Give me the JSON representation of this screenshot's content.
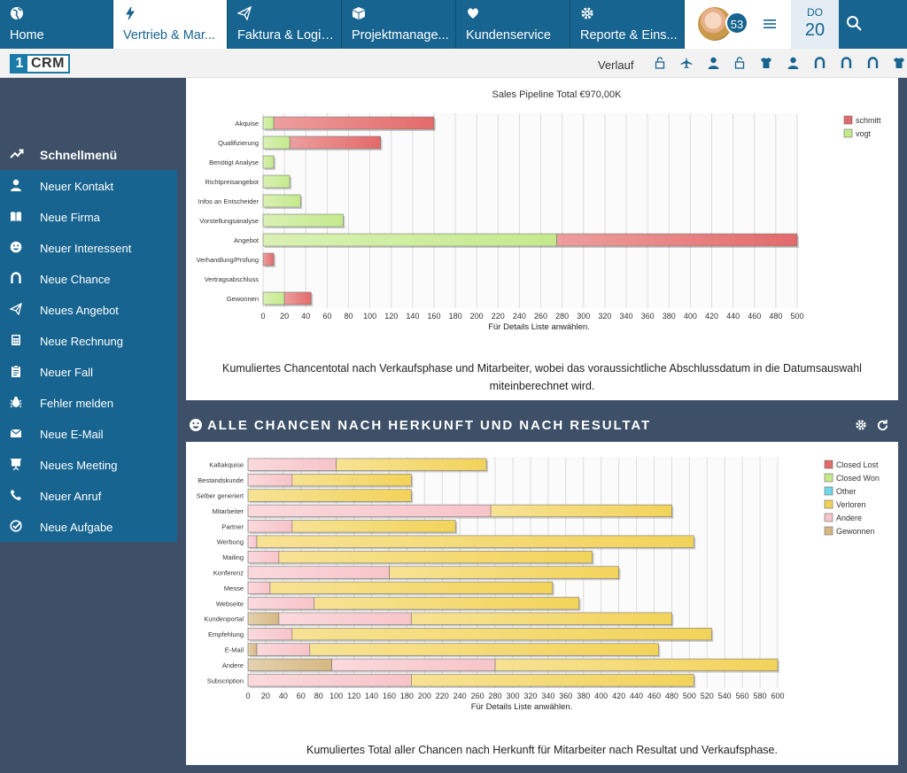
{
  "topnav": {
    "tabs": [
      {
        "label": "Home",
        "icon": "globe-icon",
        "active": false
      },
      {
        "label": "Vertrieb & Mar...",
        "icon": "lightning-icon",
        "active": true
      },
      {
        "label": "Faktura & Logis...",
        "icon": "paper-plane-icon",
        "active": false
      },
      {
        "label": "Projektmanage...",
        "icon": "cube-icon",
        "active": false
      },
      {
        "label": "Kundenservice",
        "icon": "heart-icon",
        "active": false
      },
      {
        "label": "Reporte & Eins...",
        "icon": "gear-icon",
        "active": false
      }
    ],
    "badge_count": "53",
    "date_dow": "DO",
    "date_day": "20"
  },
  "subbar": {
    "logo_one": "1",
    "logo_crm": "CRM",
    "history_label": "Verlauf",
    "history_icons": [
      "lock-icon",
      "plane-icon",
      "person-icon",
      "lock-icon",
      "shirt-icon",
      "person-icon",
      "magnet-icon",
      "magnet-icon",
      "magnet-icon",
      "shirt-icon"
    ]
  },
  "sidebar": {
    "heading": "Schnellmenü",
    "items": [
      {
        "label": "Neuer Kontakt",
        "icon": "person-icon"
      },
      {
        "label": "Neue Firma",
        "icon": "book-icon"
      },
      {
        "label": "Neuer Interessent",
        "icon": "smile-icon"
      },
      {
        "label": "Neue Chance",
        "icon": "magnet-icon"
      },
      {
        "label": "Neues Angebot",
        "icon": "paper-plane-icon"
      },
      {
        "label": "Neue Rechnung",
        "icon": "calculator-icon"
      },
      {
        "label": "Neuer Fall",
        "icon": "clipboard-icon"
      },
      {
        "label": "Fehler melden",
        "icon": "bug-icon"
      },
      {
        "label": "Neue E-Mail",
        "icon": "envelope-icon"
      },
      {
        "label": "Neues Meeting",
        "icon": "presentation-icon"
      },
      {
        "label": "Neuer Anruf",
        "icon": "phone-icon"
      },
      {
        "label": "Neue Aufgabe",
        "icon": "check-circle-icon"
      }
    ]
  },
  "panel1": {
    "caption": "Kumuliertes Chancentotal nach Verkaufsphase und Mitarbeiter, wobei das voraussichtliche Abschlussdatum in die Datumsauswahl miteinberechnet wird."
  },
  "panel2": {
    "heading": "ALLE CHANCEN NACH HERKUNFT UND NACH RESULTAT",
    "caption": "Kumuliertes Total aller Chancen nach Herkunft für Mitarbeiter nach Resultat und Verkaufsphase."
  },
  "colors": {
    "nav": "#176490",
    "red": "#e36a6a",
    "green": "#c4ea8c",
    "cyan": "#6fd8e8",
    "yellow": "#f2d35a",
    "pink": "#f7c4c9",
    "tan": "#d6b882"
  },
  "chart_data": [
    {
      "type": "bar",
      "orientation": "horizontal",
      "stacked": true,
      "title": "Sales Pipeline Total €970,00K",
      "xlabel": "Für Details Liste anwählen.",
      "xlim": [
        0,
        500
      ],
      "xticks": [
        0,
        20,
        40,
        60,
        80,
        100,
        120,
        140,
        160,
        180,
        200,
        220,
        240,
        260,
        280,
        300,
        320,
        340,
        360,
        380,
        400,
        420,
        440,
        460,
        480,
        500
      ],
      "legend_position": "top-right",
      "categories": [
        "Akquise",
        "Qualifizierung",
        "Benötigt Analyse",
        "Richtpreisangebot",
        "Infos an Entscheider",
        "Vorstellungsanalyse",
        "Angebot",
        "Verhandlung/Prüfung",
        "Vertragsabschluss",
        "Gewonnen"
      ],
      "series": [
        {
          "name": "vogt",
          "color": "#c4ea8c",
          "values": [
            10,
            25,
            10,
            25,
            35,
            75,
            275,
            0,
            0,
            20
          ]
        },
        {
          "name": "schmitt",
          "color": "#e36a6a",
          "values": [
            150,
            85,
            0,
            0,
            0,
            0,
            225,
            10,
            0,
            25
          ]
        }
      ],
      "legend": [
        {
          "name": "schmitt",
          "color": "#e36a6a"
        },
        {
          "name": "vogt",
          "color": "#c4ea8c"
        }
      ]
    },
    {
      "type": "bar",
      "orientation": "horizontal",
      "stacked": true,
      "title": "",
      "xlabel": "Für Details Liste anwählen.",
      "xlim": [
        0,
        600
      ],
      "xticks": [
        0,
        20,
        40,
        60,
        80,
        100,
        120,
        140,
        160,
        180,
        200,
        220,
        240,
        260,
        280,
        300,
        320,
        340,
        360,
        380,
        400,
        420,
        440,
        460,
        480,
        500,
        520,
        540,
        560,
        580,
        600
      ],
      "legend_position": "top-right",
      "categories": [
        "Kaltakquise",
        "Bestandskunde",
        "Selber generiert",
        "Mitarbeiter",
        "Partner",
        "Werbung",
        "Mailing",
        "Konferenz",
        "Messe",
        "Webseite",
        "Kundenportal",
        "Empfehlung",
        "E-Mail",
        "Andere",
        "Subscription"
      ],
      "series": [
        {
          "name": "Gewonnen",
          "color": "#d6b882",
          "values": [
            0,
            0,
            0,
            0,
            0,
            0,
            0,
            0,
            0,
            0,
            35,
            0,
            10,
            95,
            0
          ]
        },
        {
          "name": "Andere",
          "color": "#f7c4c9",
          "values": [
            100,
            50,
            0,
            275,
            50,
            10,
            35,
            160,
            25,
            75,
            150,
            50,
            60,
            185,
            185
          ]
        },
        {
          "name": "Verloren",
          "color": "#f2d35a",
          "values": [
            170,
            135,
            185,
            205,
            185,
            495,
            355,
            260,
            320,
            300,
            295,
            475,
            395,
            320,
            320
          ]
        }
      ],
      "legend": [
        {
          "name": "Closed Lost",
          "color": "#e36a6a"
        },
        {
          "name": "Closed Won",
          "color": "#c4ea8c"
        },
        {
          "name": "Other",
          "color": "#6fd8e8"
        },
        {
          "name": "Verloren",
          "color": "#f2d35a"
        },
        {
          "name": "Andere",
          "color": "#f7c4c9"
        },
        {
          "name": "Gewonnen",
          "color": "#d6b882"
        }
      ]
    }
  ]
}
